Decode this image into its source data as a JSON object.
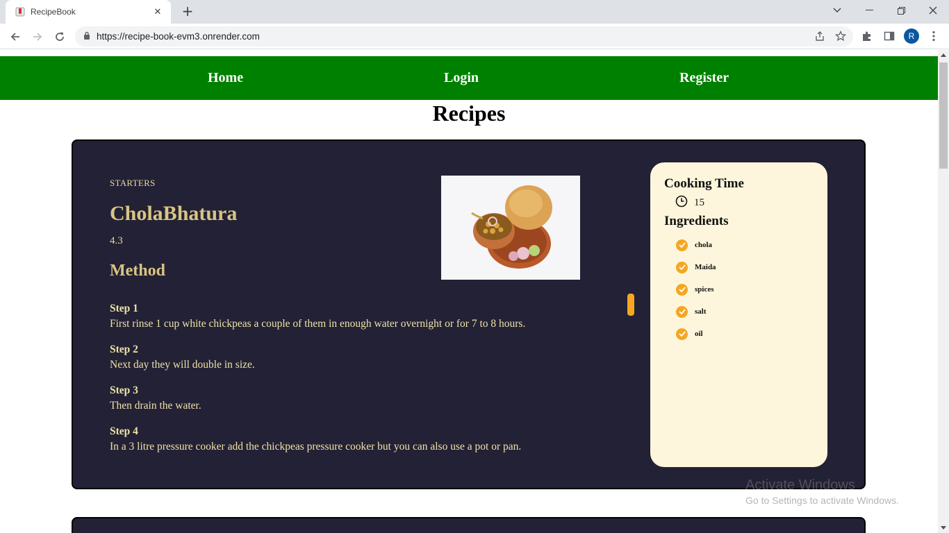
{
  "browser": {
    "tab_title": "RecipeBook",
    "tab_close": "✕",
    "new_tab": "+",
    "url": "https://recipe-book-evm3.onrender.com",
    "profile_initial": "R"
  },
  "nav": {
    "home": "Home",
    "login": "Login",
    "register": "Register",
    "bg_color": "#008000"
  },
  "page": {
    "title": "Recipes"
  },
  "recipe": {
    "category": "STARTERS",
    "name": "CholaBhatura",
    "rating": "4.3",
    "method_title": "Method",
    "steps": [
      {
        "title": "Step 1",
        "text": "First rinse 1 cup white chickpeas a couple of them in enough water overnight or for 7 to 8 hours."
      },
      {
        "title": "Step 2",
        "text": "Next day they will double in size."
      },
      {
        "title": "Step 3",
        "text": "Then drain the water."
      },
      {
        "title": "Step 4",
        "text": "In a 3 litre pressure cooker add the chickpeas pressure cooker but you can also use a pot or pan."
      }
    ],
    "cooking_time_title": "Cooking Time",
    "cooking_time": "15",
    "ingredients_title": "Ingredients",
    "ingredients": [
      "chola",
      "Maida",
      "spices",
      "salt",
      "oil"
    ],
    "card_color": "#232135",
    "accent_color": "#f5a623"
  },
  "watermark": {
    "line1": "Activate Windows",
    "line2": "Go to Settings to activate Windows."
  }
}
